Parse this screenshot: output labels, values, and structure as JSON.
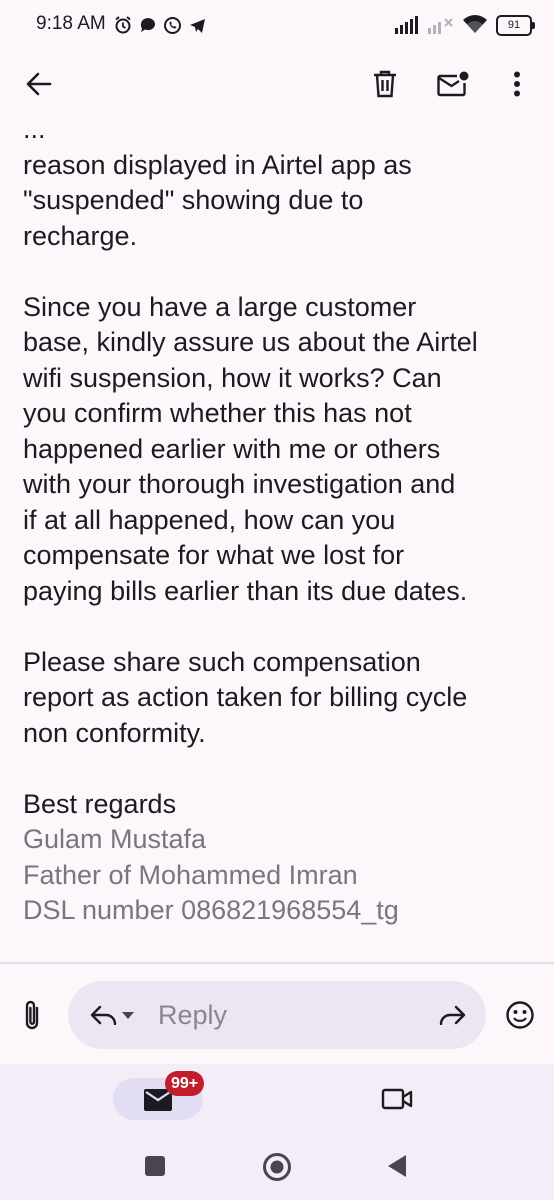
{
  "status_bar": {
    "time": "9:18 AM",
    "battery": "91",
    "icons_left": [
      "alarm-icon",
      "chat-bubble-icon",
      "whatsapp-icon",
      "telegram-icon"
    ],
    "icons_right": [
      "signal-icon",
      "signal-no-icon",
      "wifi-icon",
      "battery-icon"
    ]
  },
  "app_bar": {
    "icons": [
      "back-arrow-icon",
      "delete-icon",
      "mark-unread-icon",
      "more-vert-icon"
    ]
  },
  "email": {
    "clipped_first_line": "...",
    "paragraphs": [
      [
        "reason displayed in Airtel app as",
        "\"suspended\" showing due to",
        "recharge."
      ],
      [
        "Since you have a large customer",
        "base, kindly assure us about the Airtel",
        "wifi suspension, how it works? Can",
        "you confirm whether this has not",
        "happened earlier with me or others",
        "with your thorough investigation and",
        "if at all happened, how can you",
        "compensate for what we lost for",
        "paying bills earlier than its due dates."
      ],
      [
        "Please share such compensation",
        "report as action taken for billing cycle",
        "non conformity."
      ]
    ],
    "closing": "Best regards",
    "signature": [
      "Gulam Mustafa",
      "Father of Mohammed Imran",
      "DSL number 086821968554_tg"
    ]
  },
  "reply_bar": {
    "placeholder": "Reply",
    "icons": [
      "attachment-icon",
      "reply-icon",
      "dropdown-icon",
      "forward-icon",
      "emoji-icon"
    ]
  },
  "bottom_nav": {
    "badge": "99+",
    "icons": [
      "mail-icon",
      "video-icon"
    ]
  },
  "system_nav": {
    "icons": [
      "recents-icon",
      "home-icon",
      "back-icon"
    ]
  },
  "colors": {
    "background": "#fdf7fc",
    "text": "#1c1b1f",
    "signature": "#79767d",
    "badge": "#c21d2a",
    "pill": "#ece6f3"
  }
}
